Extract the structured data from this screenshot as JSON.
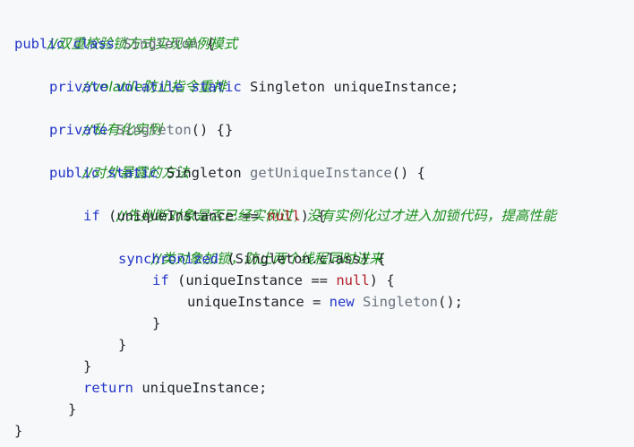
{
  "code": {
    "comment_title": "//双重校验锁方式实现单例模式",
    "l2_kw1": "public",
    "l2_kw2": "class",
    "l2_name": "Singleton",
    "l2_brace": "{",
    "comment_volatile": "//volatile防止指令重排",
    "l4_kw1": "private",
    "l4_kw2": "volatile",
    "l4_kw3": "static",
    "l4_rest": "Singleton uniqueInstance;",
    "comment_private_ctor": "//私有化实例",
    "l6_kw": "private",
    "l6_name": "Singleton",
    "l6_rest": "() {}",
    "comment_public_method": "//对外暴露的方法",
    "l8_kw1": "public",
    "l8_kw2": "static",
    "l8_type": "Singleton",
    "l8_method": "getUniqueInstance",
    "l8_rest": "() {",
    "comment_check": "//先判断对象是否已经实例过，没有实例化过才进入加锁代码，提高性能",
    "l10_kw": "if",
    "l10_a": "(uniqueInstance ==",
    "l10_null": "null",
    "l10_b": ") {",
    "comment_lock": "//类对象加锁，防止两个线程同时进来",
    "l12_kw": "synchronized",
    "l12_rest": "(Singleton.class) {",
    "l13_kw": "if",
    "l13_a": "(uniqueInstance ==",
    "l13_null": "null",
    "l13_b": ") {",
    "l14_a": "uniqueInstance =",
    "l14_new": "new",
    "l14_name": "Singleton",
    "l14_b": "();",
    "l15": "}",
    "l16": "}",
    "l17": "}",
    "l18_kw": "return",
    "l18_rest": "uniqueInstance;",
    "l19": "}",
    "l20": "}"
  },
  "colors": {
    "keyword": "#2436c8",
    "type_name": "#6a737d",
    "null_literal": "#b31d28",
    "comment": "#1a8f1a",
    "background": "#f6f8fa"
  }
}
